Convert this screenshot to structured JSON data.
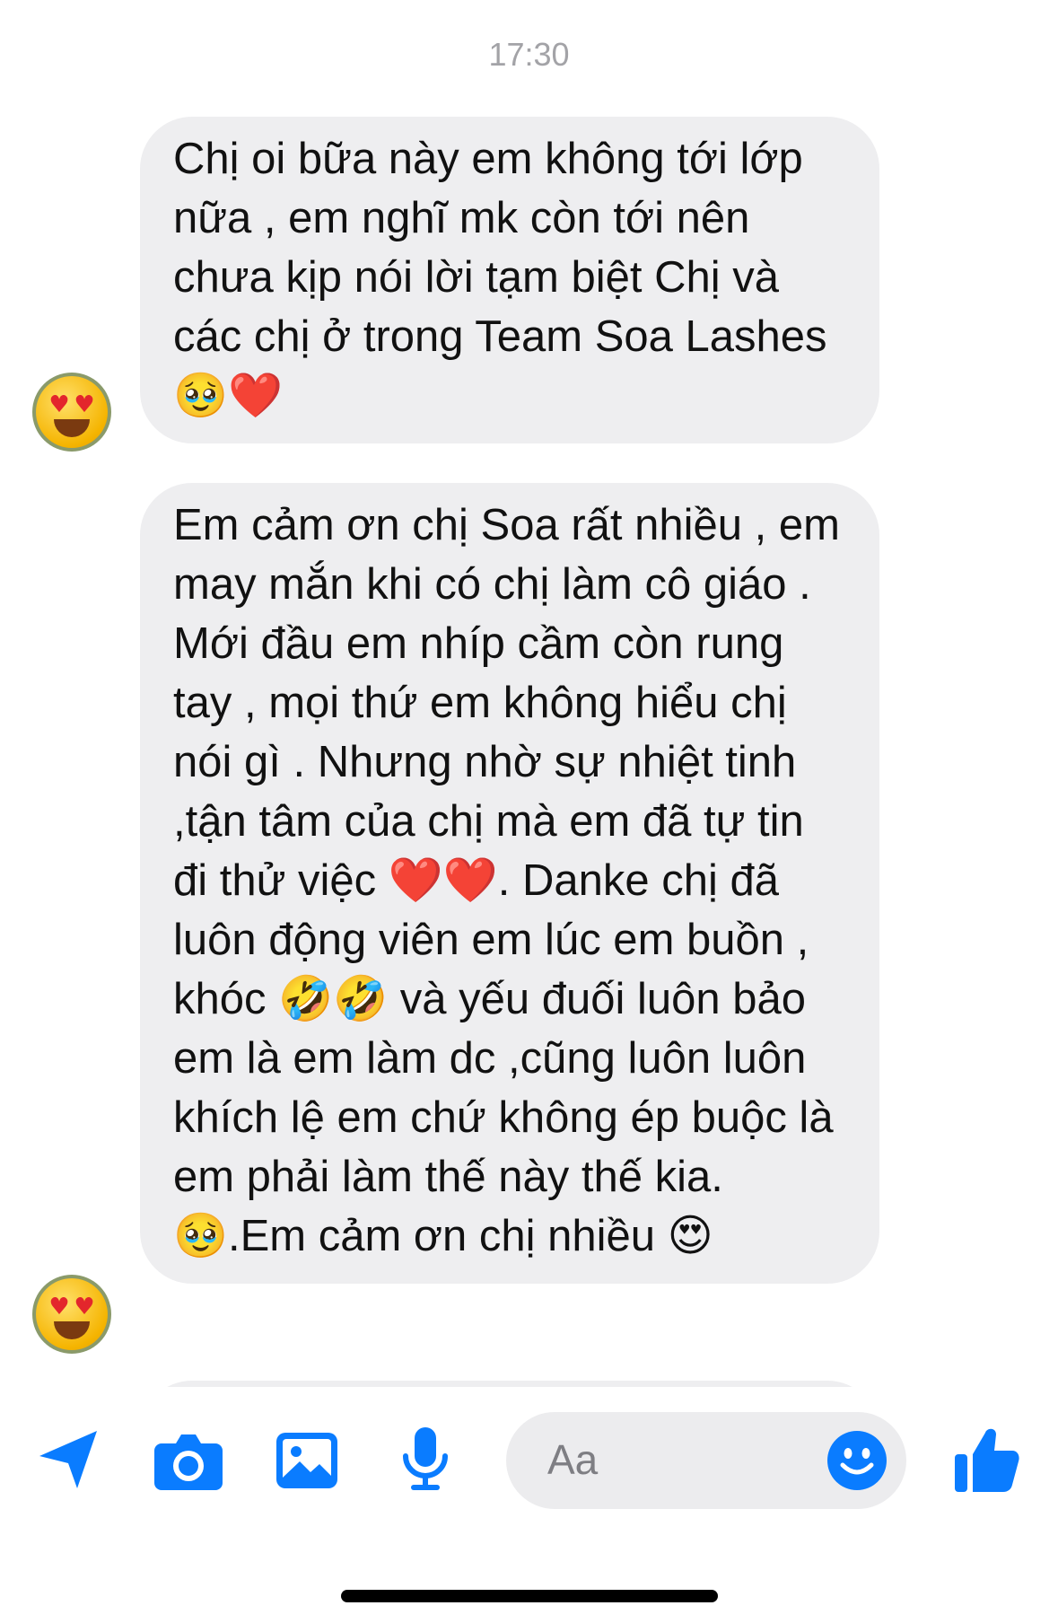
{
  "timestamp": "17:30",
  "messages": [
    {
      "text": "Chị oi bữa này em không tới lớp nữa , em nghĩ mk còn tới nên chưa kịp nói lời tạm biệt Chị và các chị ở trong Team Soa Lashes 🥹❤️"
    },
    {
      "text": "Em cảm ơn chị Soa rất nhiều , em may mắn khi có chị làm cô giáo . Mới đầu em nhíp cầm còn rung tay , mọi thứ em không hiểu chị nói gì . Nhưng nhờ sự nhiệt tinh ,tận tâm của chị mà em đã tự tin đi thử việc ❤️❤️. Danke chị đã luôn động viên em lúc em buồn , khóc 🤣🤣 và yếu đuối luôn bảo em là em làm dc ,cũng luôn luôn khích lệ em chứ không ép buộc là em phải làm thế này thế kia. 🥹.Em cảm ơn chị nhiều 😍"
    }
  ],
  "composer": {
    "placeholder": "Aa"
  },
  "icons": {
    "send": "paper-plane-icon",
    "camera": "camera-icon",
    "gallery": "image-icon",
    "voice": "microphone-icon",
    "emoji": "smile-icon",
    "like": "thumbs-up-icon"
  },
  "colors": {
    "accent": "#0a7cff",
    "bubble": "#eeeef0",
    "timestamp": "#a3a3a7"
  }
}
